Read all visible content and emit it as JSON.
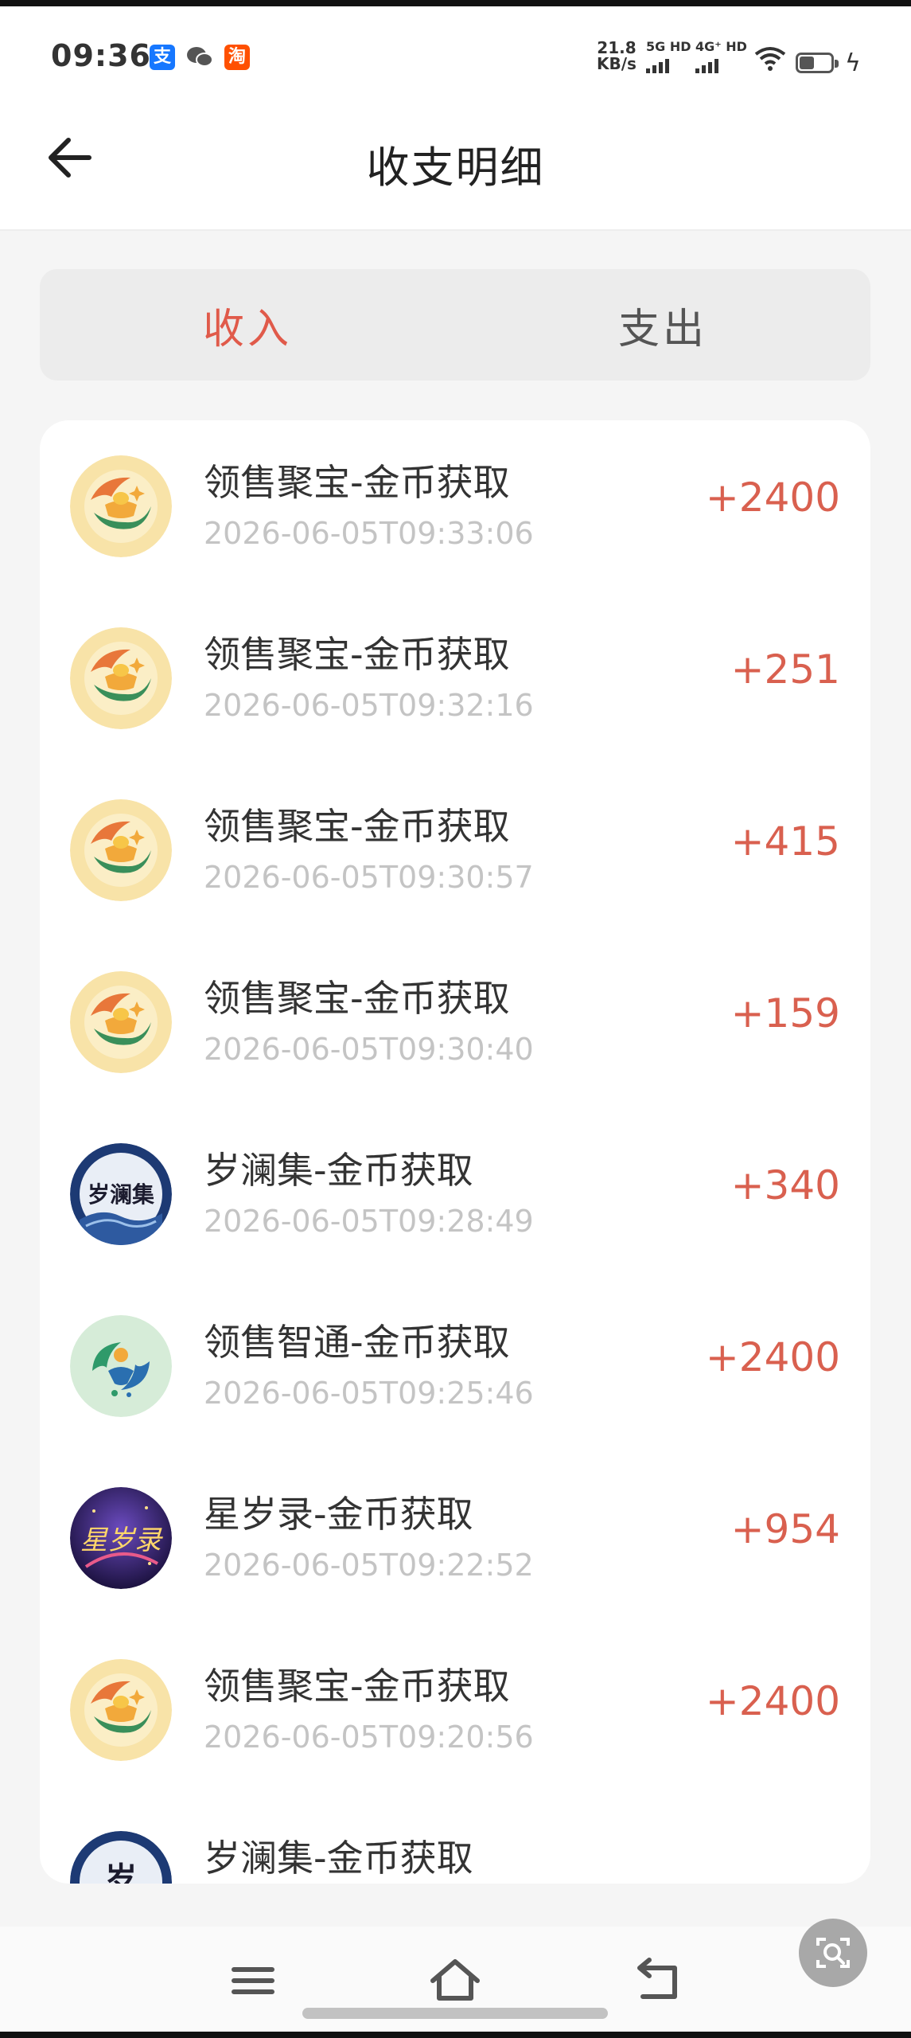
{
  "status_bar": {
    "time": "09:36",
    "app_icons": [
      {
        "name": "alipay-icon",
        "glyph": "支"
      },
      {
        "name": "wechat-icon",
        "glyph": "✆"
      },
      {
        "name": "taobao-icon",
        "glyph": "淘"
      }
    ],
    "net_speed_value": "21.8",
    "net_speed_unit": "KB/s",
    "signal_1_label": "5G HD",
    "signal_2_label": "4G⁺ HD"
  },
  "header": {
    "title": "收支明细"
  },
  "tabs": [
    {
      "label": "收入",
      "active": true
    },
    {
      "label": "支出",
      "active": false
    }
  ],
  "transactions": [
    {
      "title": "领售聚宝-金币获取",
      "time": "2026-06-05T09:33:06",
      "amount": "+2400",
      "avatar": "gold-ingot-logo-icon"
    },
    {
      "title": "领售聚宝-金币获取",
      "time": "2026-06-05T09:32:16",
      "amount": "+251",
      "avatar": "gold-ingot-logo-icon"
    },
    {
      "title": "领售聚宝-金币获取",
      "time": "2026-06-05T09:30:57",
      "amount": "+415",
      "avatar": "gold-ingot-logo-icon"
    },
    {
      "title": "领售聚宝-金币获取",
      "time": "2026-06-05T09:30:40",
      "amount": "+159",
      "avatar": "gold-ingot-logo-icon"
    },
    {
      "title": "岁澜集-金币获取",
      "time": "2026-06-05T09:28:49",
      "amount": "+340",
      "avatar": "suilanji-logo-icon",
      "logo_text": "岁澜集"
    },
    {
      "title": "领售智通-金币获取",
      "time": "2026-06-05T09:25:46",
      "amount": "+2400",
      "avatar": "zhitong-logo-icon"
    },
    {
      "title": "星岁录-金币获取",
      "time": "2026-06-05T09:22:52",
      "amount": "+954",
      "avatar": "xingsuilu-logo-icon",
      "logo_text": "星岁录"
    },
    {
      "title": "领售聚宝-金币获取",
      "time": "2026-06-05T09:20:56",
      "amount": "+2400",
      "avatar": "gold-ingot-logo-icon"
    },
    {
      "title": "岁澜集-金币获取",
      "time": "",
      "amount": "",
      "avatar": "suilanji-logo-icon",
      "logo_text": "岁"
    }
  ],
  "colors": {
    "accent": "#e05a4a",
    "amount": "#d9604f",
    "muted_time": "#c4c4c4"
  },
  "nav": {
    "menu_icon": "menu-icon",
    "home_icon": "home-icon",
    "back_icon": "back-icon",
    "lens_icon": "screen-search-icon"
  }
}
